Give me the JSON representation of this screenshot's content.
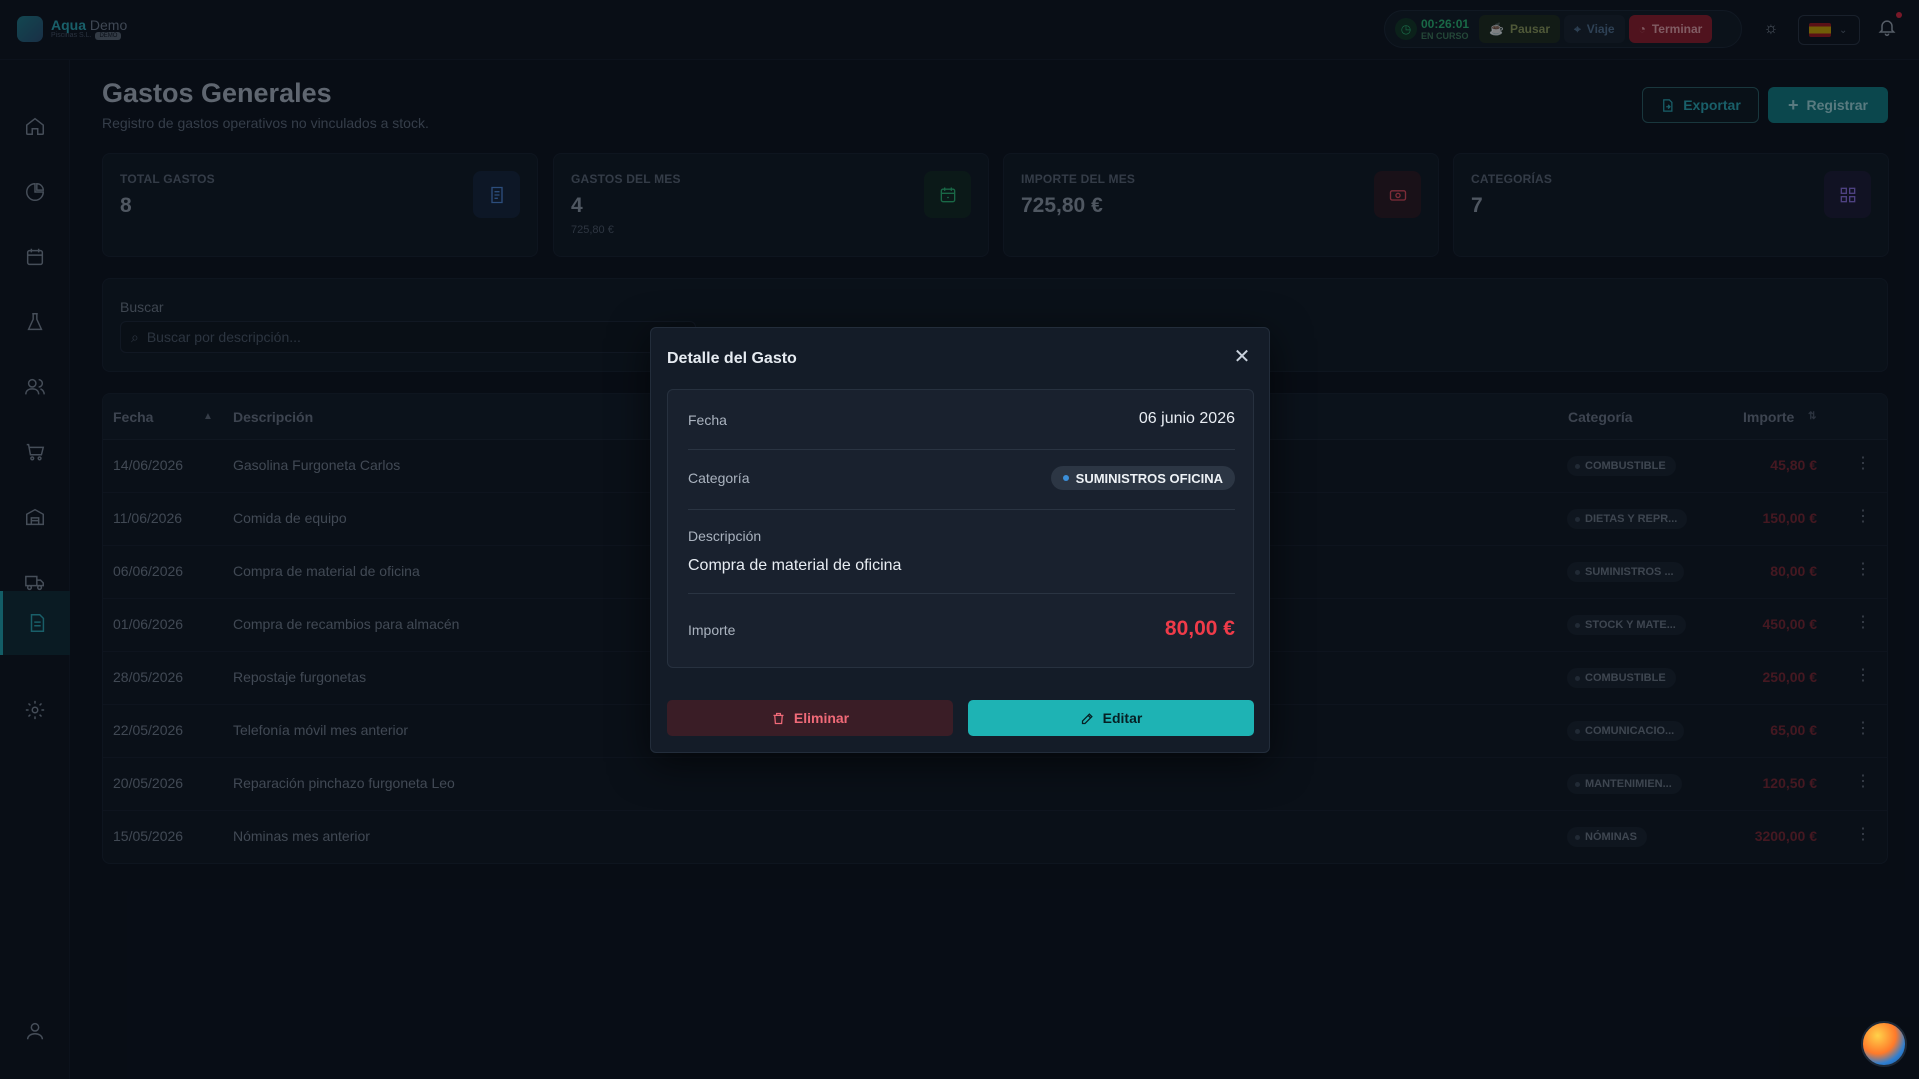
{
  "app": {
    "name_primary": "Aqua",
    "name_secondary": "Demo",
    "sub": "Piscinas S.L.",
    "badge": "DEMO"
  },
  "session": {
    "timer": "00:26:01",
    "status": "EN CURSO",
    "pause_label": "Pausar",
    "trip_label": "Viaje",
    "end_label": "Terminar"
  },
  "page": {
    "title": "Gastos Generales",
    "subtitle": "Registro de gastos operativos no vinculados a stock.",
    "export_label": "Exportar",
    "register_label": "Registrar"
  },
  "stats": [
    {
      "label": "TOTAL GASTOS",
      "value": "8",
      "sub": "",
      "icon": "receipt-icon",
      "color": "#4e86d6"
    },
    {
      "label": "GASTOS DEL MES",
      "value": "4",
      "sub": "725,80 €",
      "icon": "calendar-icon",
      "color": "#2bb673"
    },
    {
      "label": "IMPORTE DEL MES",
      "value": "725,80 €",
      "sub": "",
      "icon": "cash-icon",
      "color": "#e04a5a"
    },
    {
      "label": "CATEGORÍAS",
      "value": "7",
      "sub": "",
      "icon": "grid-icon",
      "color": "#8b6fe0"
    }
  ],
  "search": {
    "label": "Buscar",
    "placeholder": "Buscar por descripción..."
  },
  "table": {
    "columns": {
      "date": "Fecha",
      "description": "Descripción",
      "category": "Categoría",
      "amount": "Importe"
    },
    "rows": [
      {
        "date": "14/06/2026",
        "description": "Gasolina Furgoneta Carlos",
        "category": "COMBUSTIBLE",
        "amount": "45,80 €"
      },
      {
        "date": "11/06/2026",
        "description": "Comida de equipo",
        "category": "DIETAS Y REPR...",
        "amount": "150,00 €"
      },
      {
        "date": "06/06/2026",
        "description": "Compra de material de oficina",
        "category": "SUMINISTROS ...",
        "amount": "80,00 €"
      },
      {
        "date": "01/06/2026",
        "description": "Compra de recambios para almacén",
        "category": "STOCK Y MATE...",
        "amount": "450,00 €"
      },
      {
        "date": "28/05/2026",
        "description": "Repostaje furgonetas",
        "category": "COMBUSTIBLE",
        "amount": "250,00 €"
      },
      {
        "date": "22/05/2026",
        "description": "Telefonía móvil mes anterior",
        "category": "COMUNICACIO...",
        "amount": "65,00 €"
      },
      {
        "date": "20/05/2026",
        "description": "Reparación pinchazo furgoneta Leo",
        "category": "MANTENIMIEN...",
        "amount": "120,50 €"
      },
      {
        "date": "15/05/2026",
        "description": "Nóminas mes anterior",
        "category": "NÓMINAS",
        "amount": "3200,00 €"
      }
    ]
  },
  "modal": {
    "title": "Detalle del Gasto",
    "date_label": "Fecha",
    "date_value": "06 junio 2026",
    "category_label": "Categoría",
    "category_value": "SUMINISTROS OFICINA",
    "description_label": "Descripción",
    "description_value": "Compra de material de oficina",
    "amount_label": "Importe",
    "amount_value": "80,00 €",
    "delete_label": "Eliminar",
    "edit_label": "Editar"
  }
}
